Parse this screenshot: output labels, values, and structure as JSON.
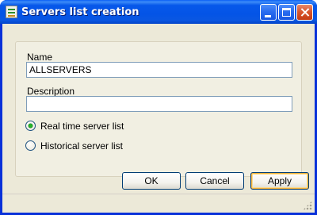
{
  "window": {
    "title": "Servers list creation",
    "icon": "document-list-icon",
    "controls": [
      "minimize-icon",
      "maximize-icon",
      "close-icon"
    ]
  },
  "form": {
    "name_label": "Name",
    "name_value": "ALLSERVERS",
    "description_label": "Description",
    "description_value": "",
    "radio_options": [
      {
        "label": "Real time server list",
        "checked": true
      },
      {
        "label": "Historical server list",
        "checked": false
      }
    ]
  },
  "buttons": {
    "ok": "OK",
    "cancel": "Cancel",
    "apply": "Apply"
  },
  "colors": {
    "titlebar": "#0454e6",
    "dialog_bg": "#ece9d8",
    "field_border": "#7f9db9",
    "radio_checked": "#24b32a"
  }
}
